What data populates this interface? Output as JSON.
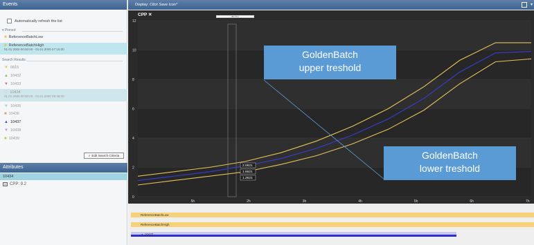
{
  "events_panel": {
    "title": "Events",
    "auto_refresh_label": "Automatically refresh the list",
    "pinned_label": "Pinned",
    "pinned": [
      {
        "label": "ReferenceBatchLow",
        "sub": ""
      },
      {
        "label": "ReferenceBatchHigh",
        "sub": "01.01.2000 00:00:00 - 01.01.2000 07:15:00"
      }
    ],
    "search_label": "Search Results",
    "results": [
      {
        "label": "0815",
        "sub": ""
      },
      {
        "label": "10432",
        "sub": ""
      },
      {
        "label": "10433",
        "sub": ""
      },
      {
        "label": "10434",
        "sub": "01.01.2000 00:00:00 - 01.01.2000 05:45:00"
      },
      {
        "label": "10435",
        "sub": ""
      },
      {
        "label": "10436",
        "sub": ""
      },
      {
        "label": "10437",
        "sub": ""
      },
      {
        "label": "10438",
        "sub": ""
      },
      {
        "label": "10439",
        "sub": ""
      }
    ],
    "edit_button": "Edit Search Criteria"
  },
  "attributes_panel": {
    "title": "Attributes",
    "selected": "10434",
    "item": "CPP: 9.2"
  },
  "display": {
    "label": "Display:",
    "value": "Click Save Icon*"
  },
  "chart_data": {
    "type": "line",
    "title": "CPP",
    "yticks": [
      0,
      2,
      4,
      6,
      8,
      10,
      12
    ],
    "ylim": [
      0,
      12
    ],
    "xticks": [
      "5h",
      "2h",
      "3h",
      "4h",
      "5h",
      "6h",
      "7h"
    ],
    "cursor_label": "8h 07m",
    "cursor_values": [
      "2.0621",
      "1.6621",
      "1.2621"
    ],
    "series": [
      {
        "name": "ReferenceBatchHigh",
        "color": "#e8c25a",
        "values": [
          1.4,
          1.7,
          2.0,
          2.4,
          3.0,
          3.8,
          4.8,
          6.0,
          7.5,
          9.3,
          10.5,
          10.5
        ]
      },
      {
        "name": "10437",
        "color": "#3b3bd6",
        "values": [
          1.1,
          1.4,
          1.7,
          2.1,
          2.6,
          3.3,
          4.2,
          5.3,
          6.7,
          8.5,
          9.8,
          9.9
        ]
      },
      {
        "name": "ReferenceBatchLow",
        "color": "#e8c25a",
        "values": [
          0.8,
          1.1,
          1.4,
          1.7,
          2.2,
          2.8,
          3.6,
          4.6,
          5.9,
          7.7,
          9.2,
          9.4
        ]
      }
    ]
  },
  "callouts": {
    "upper_line1": "GoldenBatch",
    "upper_line2": "upper treshold",
    "lower_line1": "GoldenBatch",
    "lower_line2": "lower treshold"
  },
  "timeline": [
    {
      "label": "ReferenceBatchLow",
      "color": "#f5d27a"
    },
    {
      "label": "ReferenceBatchHigh",
      "color": "#f5d27a"
    },
    {
      "label": "10437",
      "color": "#3b3bd6"
    }
  ]
}
